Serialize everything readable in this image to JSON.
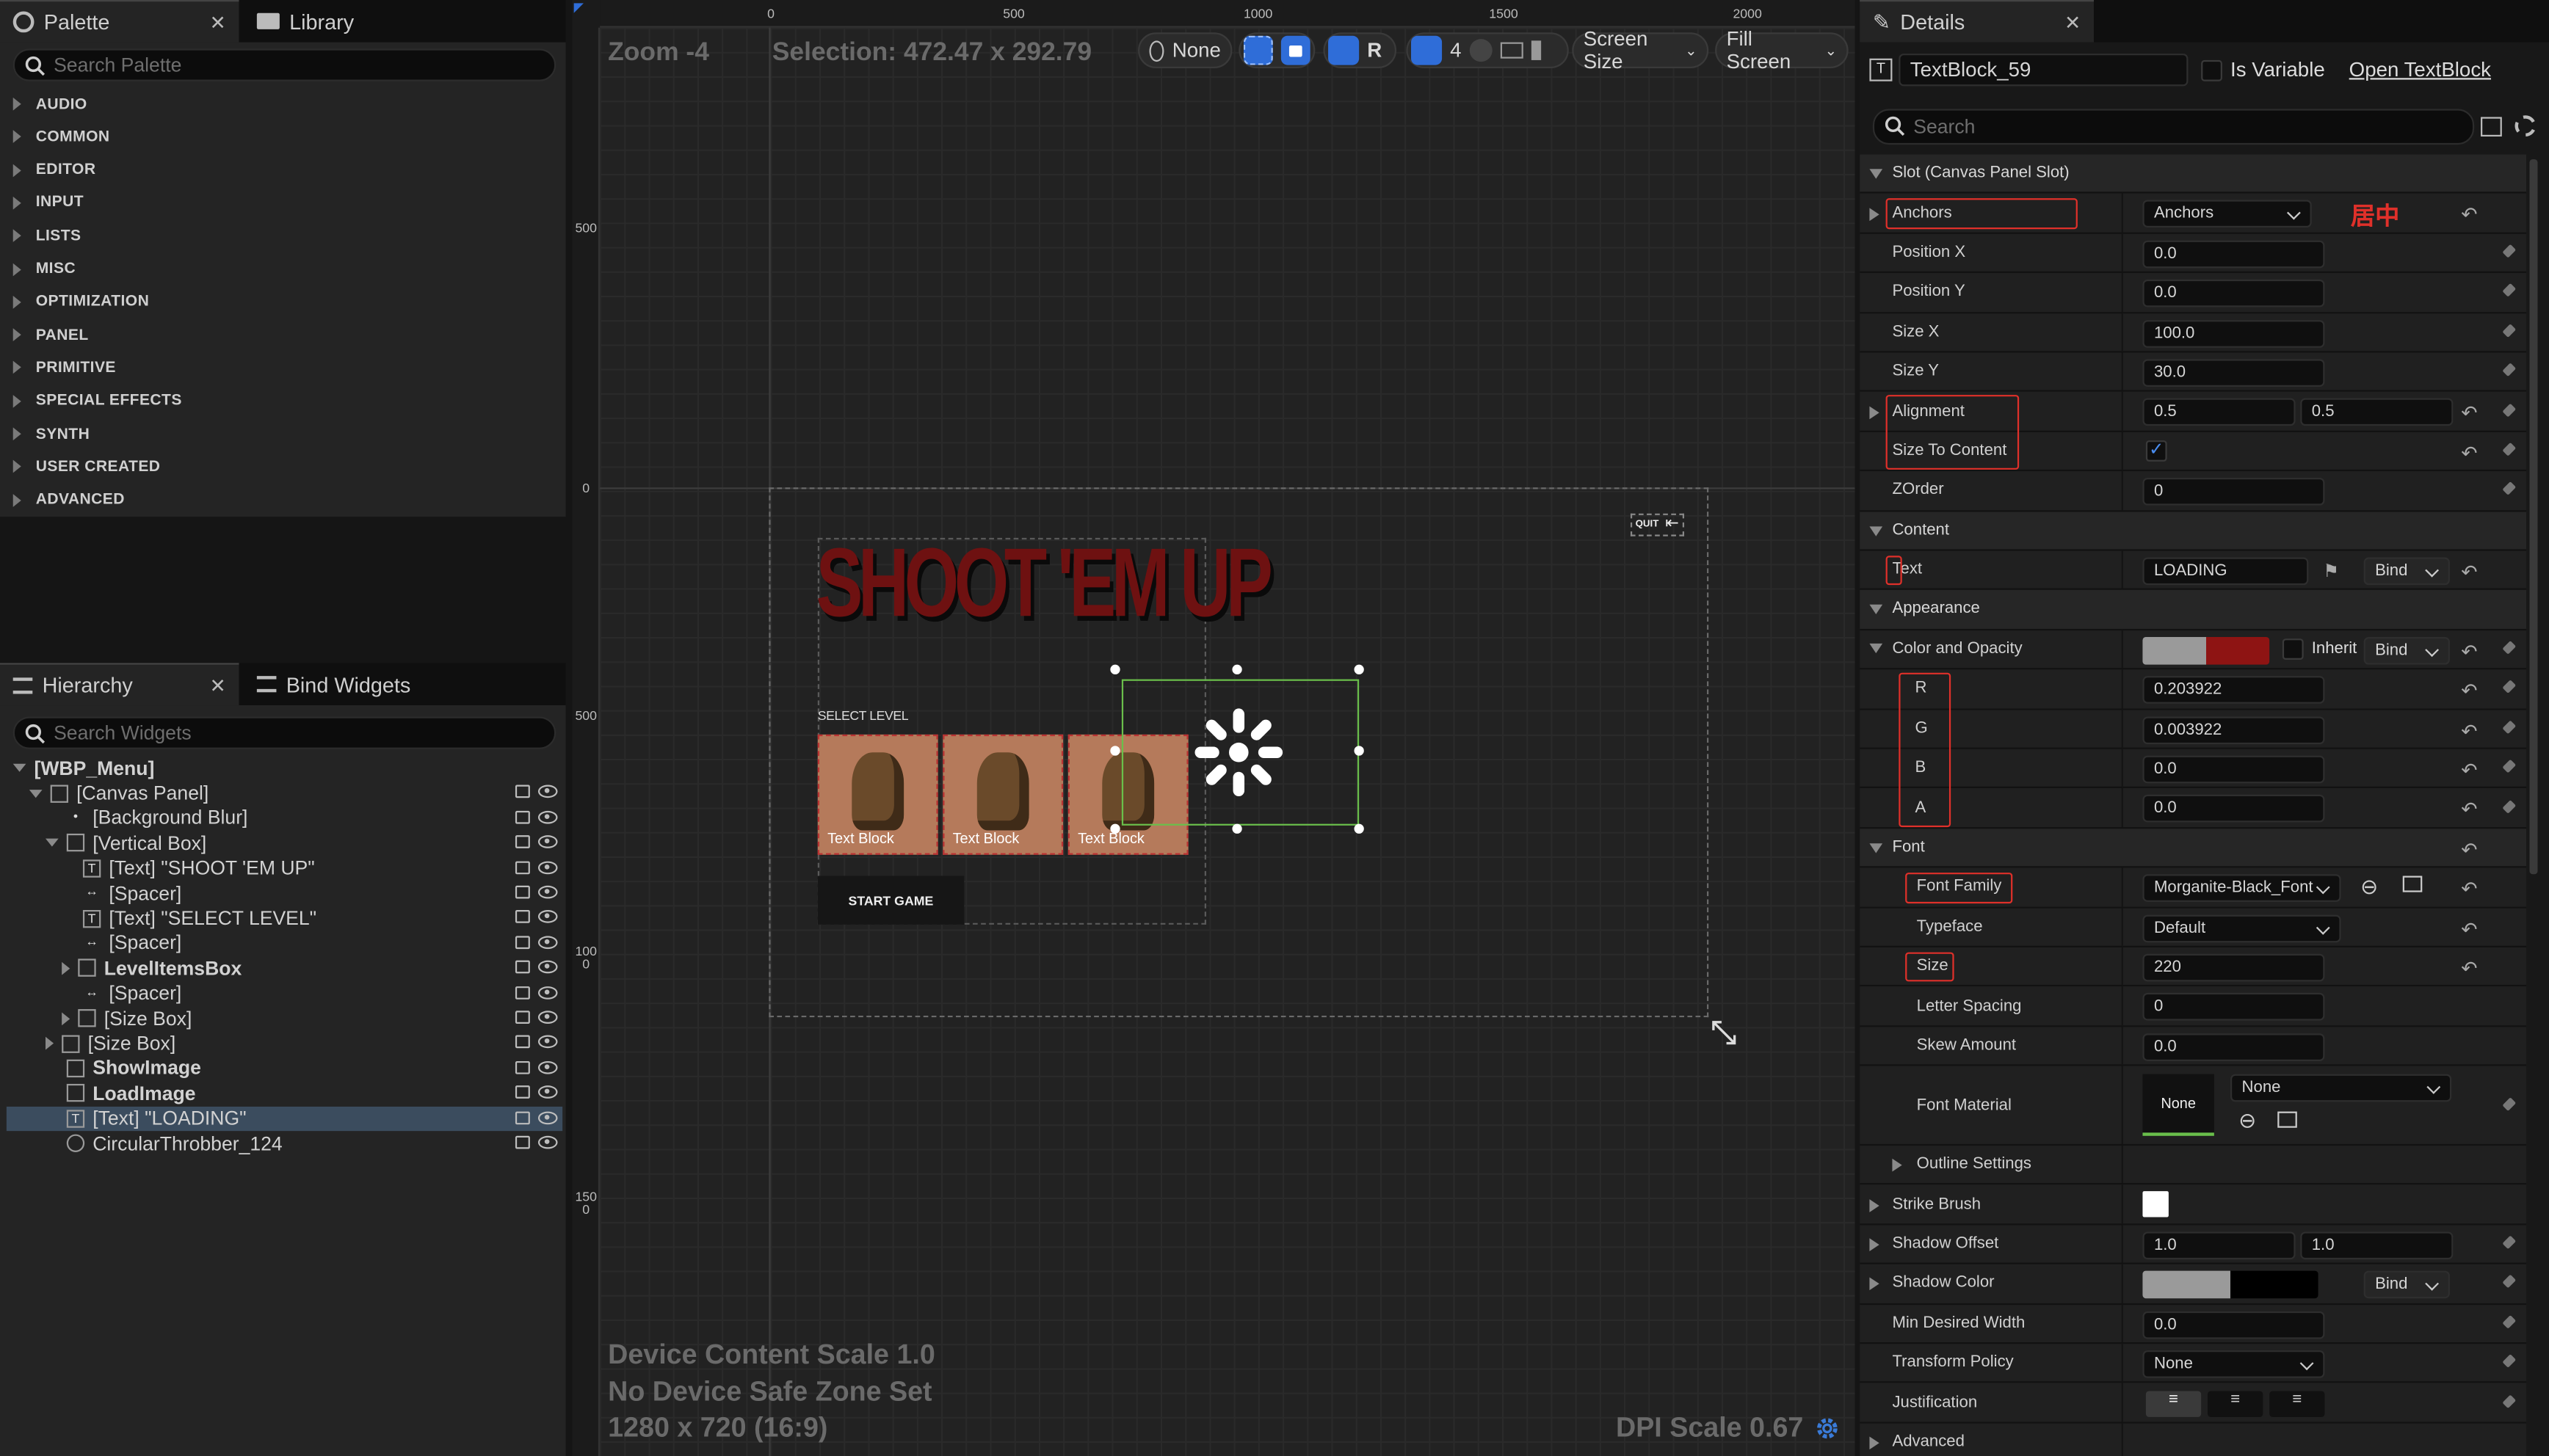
{
  "left_top": {
    "tabs": [
      {
        "label": "Palette"
      },
      {
        "label": "Library"
      }
    ],
    "search_placeholder": "Search Palette",
    "categories": [
      "AUDIO",
      "COMMON",
      "EDITOR",
      "INPUT",
      "LISTS",
      "MISC",
      "OPTIMIZATION",
      "PANEL",
      "PRIMITIVE",
      "SPECIAL EFFECTS",
      "SYNTH",
      "USER CREATED",
      "ADVANCED"
    ]
  },
  "hierarchy": {
    "tabs": [
      {
        "label": "Hierarchy"
      },
      {
        "label": "Bind Widgets"
      }
    ],
    "search_placeholder": "Search Widgets",
    "items": [
      {
        "label": "[WBP_Menu]",
        "depth": 0,
        "icon": "",
        "expander": "down",
        "bold": true,
        "selected": false
      },
      {
        "label": "[Canvas Panel]",
        "depth": 1,
        "icon": "canvas-icon",
        "expander": "down",
        "bold": false,
        "selected": false
      },
      {
        "label": "[Background Blur]",
        "depth": 2,
        "icon": "dot-icon",
        "expander": "none",
        "bold": false,
        "selected": false
      },
      {
        "label": "[Vertical Box]",
        "depth": 2,
        "icon": "vbox-icon",
        "expander": "down",
        "bold": false,
        "selected": false
      },
      {
        "label": "[Text] \"SHOOT 'EM UP\"",
        "depth": 3,
        "icon": "text-icon",
        "expander": "none",
        "bold": false,
        "selected": false
      },
      {
        "label": "[Spacer]",
        "depth": 3,
        "icon": "spacer-icon",
        "expander": "none",
        "bold": false,
        "selected": false
      },
      {
        "label": "[Text] \"SELECT LEVEL\"",
        "depth": 3,
        "icon": "text-icon",
        "expander": "none",
        "bold": false,
        "selected": false
      },
      {
        "label": "[Spacer]",
        "depth": 3,
        "icon": "spacer-icon",
        "expander": "none",
        "bold": false,
        "selected": false
      },
      {
        "label": "LevelItemsBox",
        "depth": 3,
        "icon": "hbox-icon",
        "expander": "right",
        "bold": true,
        "selected": false
      },
      {
        "label": "[Spacer]",
        "depth": 3,
        "icon": "spacer-icon",
        "expander": "none",
        "bold": false,
        "selected": false
      },
      {
        "label": "[Size Box]",
        "depth": 3,
        "icon": "sizebox-icon",
        "expander": "right",
        "bold": false,
        "selected": false
      },
      {
        "label": "[Size Box]",
        "depth": 2,
        "icon": "sizebox-icon",
        "expander": "right",
        "bold": false,
        "selected": false
      },
      {
        "label": "ShowImage",
        "depth": 2,
        "icon": "image-icon",
        "expander": "none",
        "bold": true,
        "selected": false
      },
      {
        "label": "LoadImage",
        "depth": 2,
        "icon": "image-icon",
        "expander": "none",
        "bold": true,
        "selected": false
      },
      {
        "label": "[Text] \"LOADING\"",
        "depth": 2,
        "icon": "text-icon",
        "expander": "none",
        "bold": false,
        "selected": true
      },
      {
        "label": "CircularThrobber_124",
        "depth": 2,
        "icon": "throbber-icon",
        "expander": "none",
        "bold": false,
        "selected": false
      }
    ]
  },
  "viewport": {
    "zoom_label": "Zoom -4",
    "selection_label": "Selection: 472.47 x 292.79",
    "toolbar": {
      "none_label": "None",
      "r_label": "R",
      "grid_count": "4",
      "screen_size": "Screen Size",
      "fill_screen": "Fill Screen"
    },
    "ruler_top": [
      "0",
      "500",
      "1000",
      "1500",
      "2000"
    ],
    "ruler_left": [
      "0",
      "500",
      "1000",
      "1500"
    ],
    "ruler_left_top": "500",
    "canvas": {
      "title": "SHOOT 'EM UP",
      "select_level": "SELECT LEVEL",
      "level_items": [
        "Text Block",
        "Text Block",
        "Text Block"
      ],
      "start_button": "START GAME",
      "quit_label": "QUIT"
    },
    "bottom": {
      "content_scale": "Device Content Scale 1.0",
      "safe_zone": "No Device Safe Zone Set",
      "resolution": "1280 x 720 (16:9)",
      "dpi": "DPI Scale 0.67"
    }
  },
  "details": {
    "tab": "Details",
    "widget_name": "TextBlock_59",
    "is_variable": "Is Variable",
    "open_link": "Open TextBlock",
    "search_placeholder": "Search",
    "sections": {
      "slot": "Slot (Canvas Panel Slot)",
      "content": "Content",
      "appearance": "Appearance",
      "font": "Font"
    },
    "rows": {
      "anchors": {
        "label": "Anchors",
        "value": "Anchors",
        "note": "居中"
      },
      "position_x": {
        "label": "Position X",
        "value": "0.0"
      },
      "position_y": {
        "label": "Position Y",
        "value": "0.0"
      },
      "size_x": {
        "label": "Size X",
        "value": "100.0"
      },
      "size_y": {
        "label": "Size Y",
        "value": "30.0"
      },
      "alignment": {
        "label": "Alignment",
        "v1": "0.5",
        "v2": "0.5"
      },
      "size_to_content": {
        "label": "Size To Content",
        "checked": true
      },
      "zorder": {
        "label": "ZOrder",
        "value": "0"
      },
      "text": {
        "label": "Text",
        "value": "LOADING",
        "bind": "Bind"
      },
      "color_opacity": {
        "label": "Color and Opacity",
        "inherit": "Inherit",
        "bind": "Bind",
        "color": "#8e1413"
      },
      "r": {
        "label": "R",
        "value": "0.203922"
      },
      "g": {
        "label": "G",
        "value": "0.003922"
      },
      "b": {
        "label": "B",
        "value": "0.0"
      },
      "a": {
        "label": "A",
        "value": "0.0"
      },
      "font_family": {
        "label": "Font Family",
        "value": "Morganite-Black_Font"
      },
      "typeface": {
        "label": "Typeface",
        "value": "Default"
      },
      "size": {
        "label": "Size",
        "value": "220"
      },
      "letter_spacing": {
        "label": "Letter Spacing",
        "value": "0"
      },
      "skew_amount": {
        "label": "Skew Amount",
        "value": "0.0"
      },
      "font_material": {
        "label": "Font Material",
        "thumb": "None",
        "value": "None"
      },
      "outline_settings": {
        "label": "Outline Settings"
      },
      "strike_brush": {
        "label": "Strike Brush"
      },
      "shadow_offset": {
        "label": "Shadow Offset",
        "v1": "1.0",
        "v2": "1.0"
      },
      "shadow_color": {
        "label": "Shadow Color",
        "bind": "Bind"
      },
      "min_desired_width": {
        "label": "Min Desired Width",
        "value": "0.0"
      },
      "transform_policy": {
        "label": "Transform Policy",
        "value": "None"
      },
      "justification": {
        "label": "Justification"
      },
      "advanced": {
        "label": "Advanced"
      }
    }
  },
  "colors": {
    "accent_red": "#e0302a",
    "selection_green": "#6abf4b",
    "title_red": "#7a1212"
  }
}
